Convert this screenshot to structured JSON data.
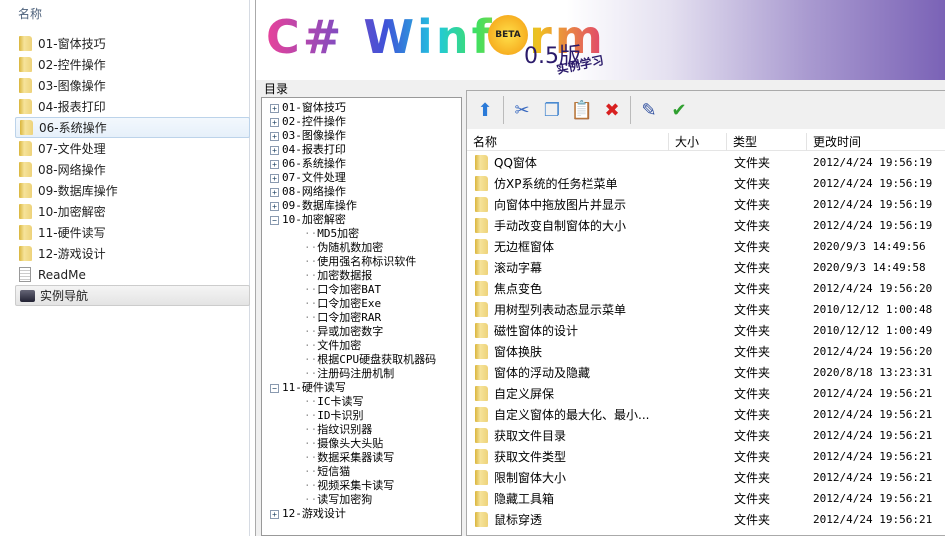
{
  "explorer": {
    "column_header": "名称",
    "items": [
      {
        "label": "01-窗体技巧",
        "icon": "folder"
      },
      {
        "label": "02-控件操作",
        "icon": "folder"
      },
      {
        "label": "03-图像操作",
        "icon": "folder"
      },
      {
        "label": "04-报表打印",
        "icon": "folder"
      },
      {
        "label": "06-系统操作",
        "icon": "folder",
        "selected": true
      },
      {
        "label": "07-文件处理",
        "icon": "folder"
      },
      {
        "label": "08-网络操作",
        "icon": "folder"
      },
      {
        "label": "09-数据库操作",
        "icon": "folder"
      },
      {
        "label": "10-加密解密",
        "icon": "folder"
      },
      {
        "label": "11-硬件读写",
        "icon": "folder"
      },
      {
        "label": "12-游戏设计",
        "icon": "folder"
      },
      {
        "label": "ReadMe",
        "icon": "document"
      },
      {
        "label": "实例导航",
        "icon": "monitor",
        "hover": true
      }
    ]
  },
  "banner": {
    "logo": "C# Winform",
    "badge": "BETA",
    "version": "0.5版",
    "subtitle": "实例学习"
  },
  "tree": {
    "label": "目录",
    "nodes": [
      {
        "t": "01-窗体技巧",
        "l": 0,
        "s": "+"
      },
      {
        "t": "02-控件操作",
        "l": 0,
        "s": "+"
      },
      {
        "t": "03-图像操作",
        "l": 0,
        "s": "+"
      },
      {
        "t": "04-报表打印",
        "l": 0,
        "s": "+"
      },
      {
        "t": "06-系统操作",
        "l": 0,
        "s": "+"
      },
      {
        "t": "07-文件处理",
        "l": 0,
        "s": "+"
      },
      {
        "t": "08-网络操作",
        "l": 0,
        "s": "+"
      },
      {
        "t": "09-数据库操作",
        "l": 0,
        "s": "+"
      },
      {
        "t": "10-加密解密",
        "l": 0,
        "s": "-"
      },
      {
        "t": "MD5加密",
        "l": 1
      },
      {
        "t": "伪随机数加密",
        "l": 1
      },
      {
        "t": "使用强名称标识软件",
        "l": 1
      },
      {
        "t": "加密数据报",
        "l": 1
      },
      {
        "t": "口令加密BAT",
        "l": 1
      },
      {
        "t": "口令加密Exe",
        "l": 1
      },
      {
        "t": "口令加密RAR",
        "l": 1
      },
      {
        "t": "异或加密数字",
        "l": 1
      },
      {
        "t": "文件加密",
        "l": 1
      },
      {
        "t": "根据CPU硬盘获取机器码",
        "l": 1
      },
      {
        "t": "注册码注册机制",
        "l": 1
      },
      {
        "t": "11-硬件读写",
        "l": 0,
        "s": "-"
      },
      {
        "t": "IC卡读写",
        "l": 1
      },
      {
        "t": "ID卡识别",
        "l": 1
      },
      {
        "t": "指纹识别器",
        "l": 1
      },
      {
        "t": "摄像头大头贴",
        "l": 1
      },
      {
        "t": "数据采集器读写",
        "l": 1
      },
      {
        "t": "短信猫",
        "l": 1
      },
      {
        "t": "视频采集卡读写",
        "l": 1
      },
      {
        "t": "读写加密狗",
        "l": 1
      },
      {
        "t": "12-游戏设计",
        "l": 0,
        "s": "+"
      }
    ]
  },
  "toolbar": [
    {
      "icon": "up-icon",
      "g": "⬆",
      "c": "#2a7ad8"
    },
    {
      "icon": "cut-icon",
      "g": "✂",
      "c": "#3a6ac0"
    },
    {
      "icon": "copy-icon",
      "g": "❐",
      "c": "#4a8ad0"
    },
    {
      "icon": "paste-icon",
      "g": "📋",
      "c": "#d8a020"
    },
    {
      "icon": "delete-icon",
      "g": "✖",
      "c": "#d82020"
    },
    {
      "icon": "rename-icon",
      "g": "✎",
      "c": "#3050a0"
    },
    {
      "icon": "ok-icon",
      "g": "✔",
      "c": "#30a030"
    }
  ],
  "list": {
    "columns": [
      "名称",
      "大小",
      "类型",
      "更改时间"
    ],
    "rows": [
      [
        "QQ窗体",
        "",
        "文件夹",
        "2012/4/24 19:56:19"
      ],
      [
        "仿XP系统的任务栏菜单",
        "",
        "文件夹",
        "2012/4/24 19:56:19"
      ],
      [
        "向窗体中拖放图片并显示",
        "",
        "文件夹",
        "2012/4/24 19:56:19"
      ],
      [
        "手动改变自制窗体的大小",
        "",
        "文件夹",
        "2012/4/24 19:56:19"
      ],
      [
        "无边框窗体",
        "",
        "文件夹",
        "2020/9/3 14:49:56"
      ],
      [
        "滚动字幕",
        "",
        "文件夹",
        "2020/9/3 14:49:58"
      ],
      [
        "焦点变色",
        "",
        "文件夹",
        "2012/4/24 19:56:20"
      ],
      [
        "用树型列表动态显示菜单",
        "",
        "文件夹",
        "2010/12/12 1:00:48"
      ],
      [
        "磁性窗体的设计",
        "",
        "文件夹",
        "2010/12/12 1:00:49"
      ],
      [
        "窗体换肤",
        "",
        "文件夹",
        "2012/4/24 19:56:20"
      ],
      [
        "窗体的浮动及隐藏",
        "",
        "文件夹",
        "2020/8/18 13:23:31"
      ],
      [
        "自定义屏保",
        "",
        "文件夹",
        "2012/4/24 19:56:21"
      ],
      [
        "自定义窗体的最大化、最小...",
        "",
        "文件夹",
        "2012/4/24 19:56:21"
      ],
      [
        "获取文件目录",
        "",
        "文件夹",
        "2012/4/24 19:56:21"
      ],
      [
        "获取文件类型",
        "",
        "文件夹",
        "2012/4/24 19:56:21"
      ],
      [
        "限制窗体大小",
        "",
        "文件夹",
        "2012/4/24 19:56:21"
      ],
      [
        "隐藏工具箱",
        "",
        "文件夹",
        "2012/4/24 19:56:21"
      ],
      [
        "鼠标穿透",
        "",
        "文件夹",
        "2012/4/24 19:56:21"
      ]
    ]
  }
}
